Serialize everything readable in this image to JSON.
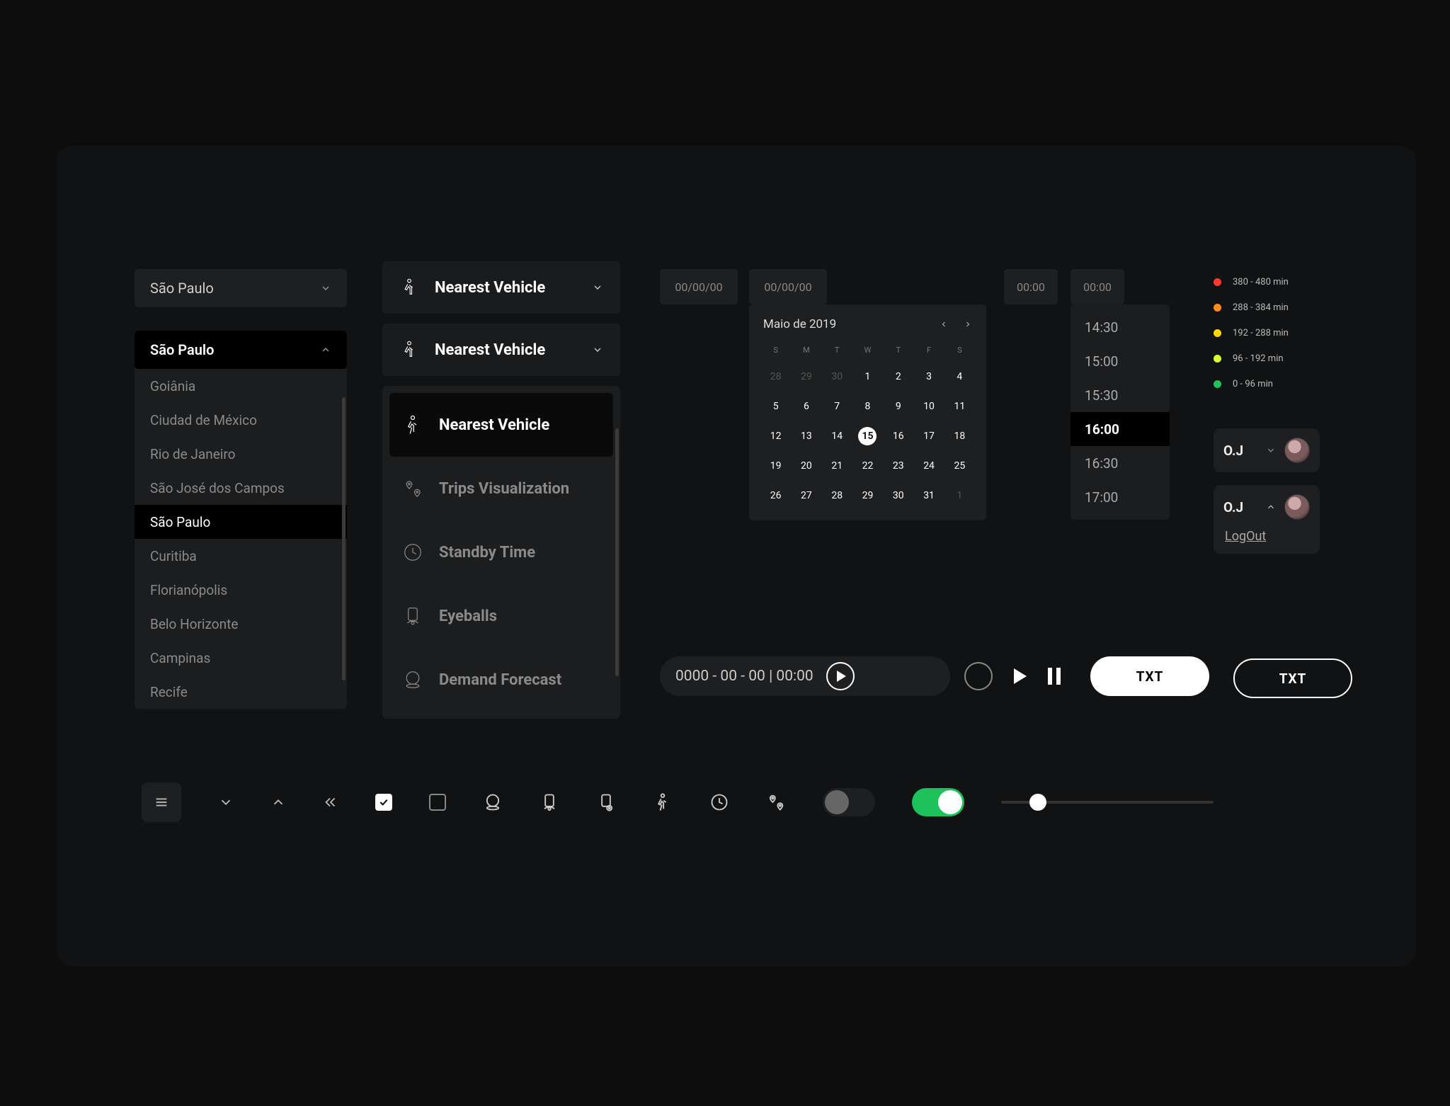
{
  "city_select": {
    "closed_value": "São Paulo",
    "open_value": "São Paulo",
    "options": [
      "Goiânia",
      "Ciudad de México",
      "Rio de Janeiro",
      "São José dos Campos",
      "São Paulo",
      "Curitiba",
      "Florianópolis",
      "Belo Horizonte",
      "Campinas",
      "Recife"
    ],
    "selected_index": 4
  },
  "nearest_vehicle": {
    "closed_label_1": "Nearest Vehicle",
    "closed_label_2": "Nearest Vehicle",
    "options": [
      {
        "icon": "walk",
        "label": "Nearest Vehicle"
      },
      {
        "icon": "trips",
        "label": "Trips Visualization"
      },
      {
        "icon": "clock",
        "label": "Standby Time"
      },
      {
        "icon": "eye",
        "label": "Eyeballs"
      },
      {
        "icon": "forecast",
        "label": "Demand Forecast"
      }
    ],
    "selected_index": 0
  },
  "date_field_1": "00/00/00",
  "date_field_2": "00/00/00",
  "time_field_1": "00:00",
  "time_field_2": "00:00",
  "calendar": {
    "title": "Maio de 2019",
    "weekdays": [
      "S",
      "M",
      "T",
      "W",
      "T",
      "F",
      "S"
    ],
    "days": [
      {
        "n": "28",
        "muted": true
      },
      {
        "n": "29",
        "muted": true
      },
      {
        "n": "30",
        "muted": true
      },
      {
        "n": "1"
      },
      {
        "n": "2"
      },
      {
        "n": "3"
      },
      {
        "n": "4"
      },
      {
        "n": "5"
      },
      {
        "n": "6"
      },
      {
        "n": "7"
      },
      {
        "n": "8"
      },
      {
        "n": "9"
      },
      {
        "n": "10"
      },
      {
        "n": "11"
      },
      {
        "n": "12"
      },
      {
        "n": "13"
      },
      {
        "n": "14"
      },
      {
        "n": "15",
        "selected": true
      },
      {
        "n": "16"
      },
      {
        "n": "17"
      },
      {
        "n": "18"
      },
      {
        "n": "19"
      },
      {
        "n": "20"
      },
      {
        "n": "21"
      },
      {
        "n": "22"
      },
      {
        "n": "23"
      },
      {
        "n": "24"
      },
      {
        "n": "25"
      },
      {
        "n": "26"
      },
      {
        "n": "27"
      },
      {
        "n": "28"
      },
      {
        "n": "29"
      },
      {
        "n": "30"
      },
      {
        "n": "31"
      },
      {
        "n": "1",
        "muted": true
      }
    ]
  },
  "time_scroller": {
    "options": [
      "14:30",
      "15:00",
      "15:30",
      "16:00",
      "16:30",
      "17:00"
    ],
    "selected_index": 3
  },
  "legend": [
    {
      "color": "#ff3b30",
      "label": "380 - 480 min"
    },
    {
      "color": "#ff8c1a",
      "label": "288 - 384 min"
    },
    {
      "color": "#ffd60a",
      "label": "192 - 288 min"
    },
    {
      "color": "#d8ff33",
      "label": "96 - 192 min"
    },
    {
      "color": "#1dc25a",
      "label": "0 - 96 min"
    }
  ],
  "user": {
    "initials": "O.J",
    "logout_label": "LogOut"
  },
  "playbar": {
    "label": "0000 - 00 - 00 | 00:00"
  },
  "buttons": {
    "txt1": "TXT",
    "txt2": "TXT"
  }
}
